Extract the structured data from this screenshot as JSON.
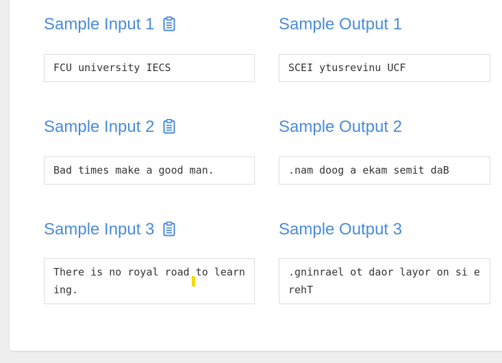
{
  "samples": [
    {
      "input_label": "Sample Input 1",
      "output_label": "Sample Output 1",
      "input_text": "FCU university IECS",
      "output_text": "SCEI ytusrevinu UCF"
    },
    {
      "input_label": "Sample Input 2",
      "output_label": "Sample Output 2",
      "input_text": "Bad times make a good man.",
      "output_text": ".nam doog a ekam semit daB"
    },
    {
      "input_label": "Sample Input 3",
      "output_label": "Sample Output 3",
      "input_text": "There is no royal road to learning.",
      "output_text": ".gninrael ot daor layor on si erehT"
    }
  ],
  "icons": {
    "copy": "clipboard-icon"
  },
  "colors": {
    "heading": "#4a8bd8",
    "border": "#dddddd",
    "text": "#333333",
    "background": "#eeeeee",
    "cursor_highlight": "#f5d800"
  }
}
